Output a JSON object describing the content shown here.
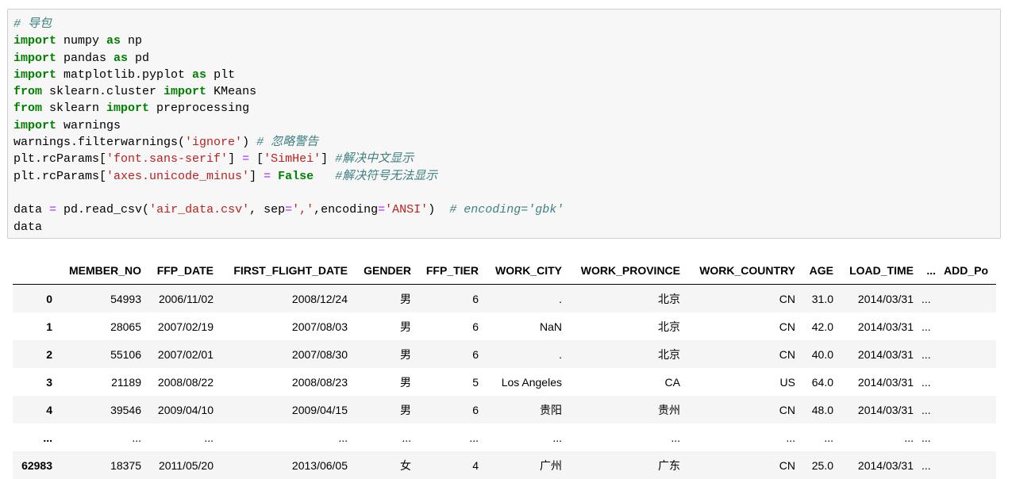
{
  "code": {
    "comment_header": "# 导包",
    "lines": [
      {
        "k1": "import",
        "t1": " numpy ",
        "k2": "as",
        "t2": " np"
      },
      {
        "k1": "import",
        "t1": " pandas ",
        "k2": "as",
        "t2": " pd"
      },
      {
        "k1": "import",
        "t1": " matplotlib.pyplot ",
        "k2": "as",
        "t2": " plt"
      },
      {
        "k1": "from",
        "t1": " sklearn.cluster ",
        "k2": "import",
        "t2": " KMeans"
      },
      {
        "k1": "from",
        "t1": " sklearn ",
        "k2": "import",
        "t2": " preprocessing"
      },
      {
        "k1": "import",
        "t1": " warnings"
      }
    ],
    "filter": {
      "a": "warnings.filterwarnings(",
      "s": "'ignore'",
      "b": ") ",
      "c": "# 忽略警告"
    },
    "rc1": {
      "a": "plt.rcParams[",
      "s": "'font.sans-serif'",
      "b": "] ",
      "op": "=",
      "c1": " [",
      "s2": "'SimHei'",
      "d": "] ",
      "c": "#解决中文显示"
    },
    "rc2": {
      "a": "plt.rcParams[",
      "s": "'axes.unicode_minus'",
      "b": "] ",
      "op": "=",
      "sp": " ",
      "kw": "False",
      "gap": "   ",
      "c": "#解决符号无法显示"
    },
    "read": {
      "a": "data ",
      "op": "=",
      "b": " pd.read_csv(",
      "s1": "'air_data.csv'",
      "c1": ", sep",
      "op2": "=",
      "s2": "','",
      "c2": ",encoding",
      "op3": "=",
      "s3": "'ANSI'",
      "d": ")  ",
      "c": "# encoding='gbk'"
    },
    "last": "data"
  },
  "table": {
    "headers": [
      "",
      "MEMBER_NO",
      "FFP_DATE",
      "FIRST_FLIGHT_DATE",
      "GENDER",
      "FFP_TIER",
      "WORK_CITY",
      "WORK_PROVINCE",
      "WORK_COUNTRY",
      "AGE",
      "LOAD_TIME",
      "...",
      "ADD_Po"
    ],
    "rows": [
      [
        "0",
        "54993",
        "2006/11/02",
        "2008/12/24",
        "男",
        "6",
        ".",
        "北京",
        "CN",
        "31.0",
        "2014/03/31",
        "...",
        ""
      ],
      [
        "1",
        "28065",
        "2007/02/19",
        "2007/08/03",
        "男",
        "6",
        "NaN",
        "北京",
        "CN",
        "42.0",
        "2014/03/31",
        "...",
        ""
      ],
      [
        "2",
        "55106",
        "2007/02/01",
        "2007/08/30",
        "男",
        "6",
        ".",
        "北京",
        "CN",
        "40.0",
        "2014/03/31",
        "...",
        ""
      ],
      [
        "3",
        "21189",
        "2008/08/22",
        "2008/08/23",
        "男",
        "5",
        "Los Angeles",
        "CA",
        "US",
        "64.0",
        "2014/03/31",
        "...",
        ""
      ],
      [
        "4",
        "39546",
        "2009/04/10",
        "2009/04/15",
        "男",
        "6",
        "贵阳",
        "贵州",
        "CN",
        "48.0",
        "2014/03/31",
        "...",
        ""
      ],
      [
        "...",
        "...",
        "...",
        "...",
        "...",
        "...",
        "...",
        "...",
        "...",
        "...",
        "...",
        "...",
        ""
      ],
      [
        "62983",
        "18375",
        "2011/05/20",
        "2013/06/05",
        "女",
        "4",
        "广州",
        "广东",
        "CN",
        "25.0",
        "2014/03/31",
        "...",
        ""
      ]
    ]
  }
}
